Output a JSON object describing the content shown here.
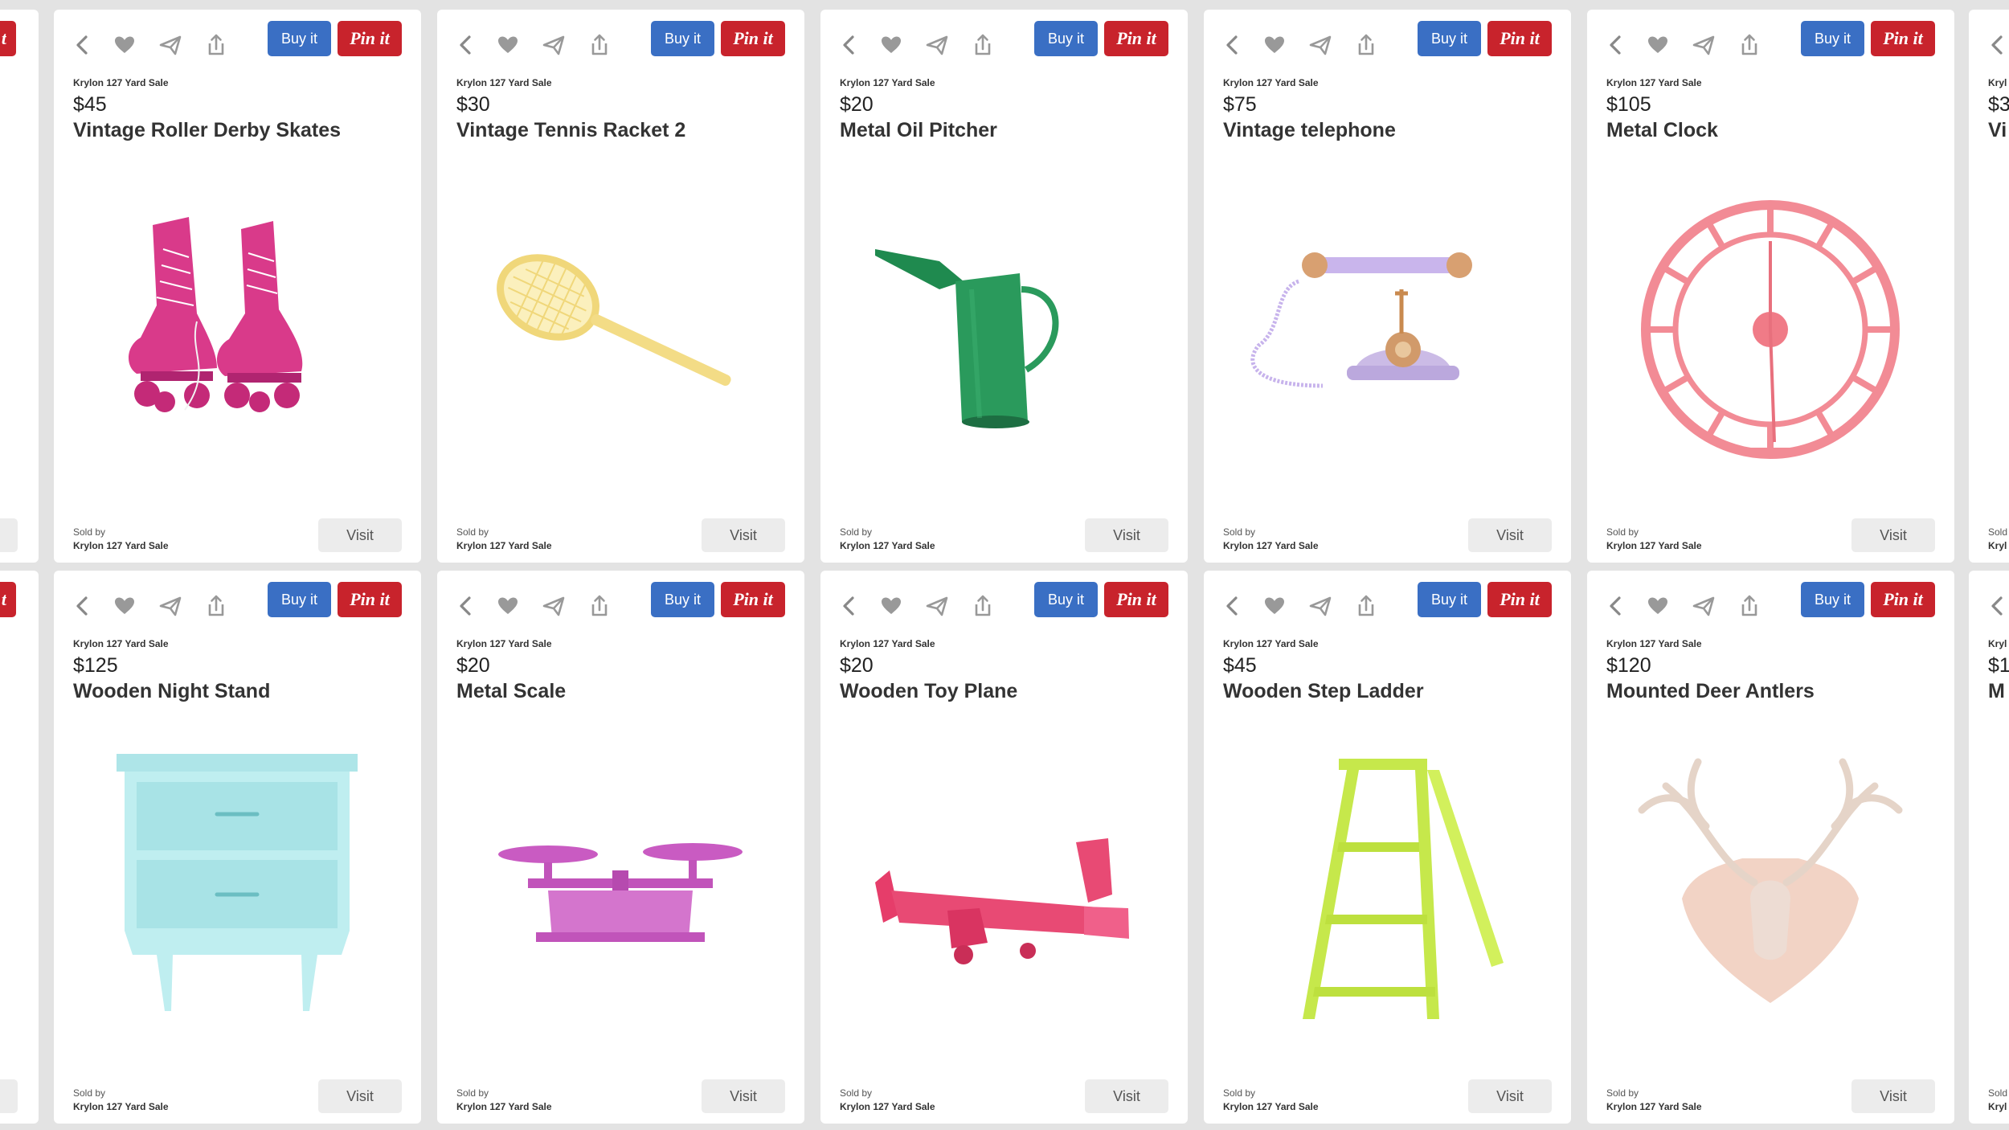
{
  "actions": {
    "buy": "Buy it",
    "pin": "Pin it",
    "visit": "Visit",
    "sold_by": "Sold by"
  },
  "seller": "Krylon 127 Yard Sale",
  "icons": [
    "back-icon",
    "heart-icon",
    "send-icon",
    "share-icon"
  ],
  "colors": {
    "buy": "#3a6fc4",
    "pin": "#c8232c",
    "background": "#e3e3e3"
  },
  "products": [
    {
      "price": "$45",
      "title": "Vintage Roller Derby Skates",
      "image": "pink roller skates"
    },
    {
      "price": "$30",
      "title": "Vintage Tennis Racket 2",
      "image": "yellow tennis racket"
    },
    {
      "price": "$20",
      "title": "Metal Oil Pitcher",
      "image": "green oil pitcher"
    },
    {
      "price": "$75",
      "title": "Vintage telephone",
      "image": "lavender rotary telephone"
    },
    {
      "price": "$105",
      "title": "Metal Clock",
      "image": "pink metal clock"
    },
    {
      "price": "$125",
      "title": "Wooden Night Stand",
      "image": "mint night stand"
    },
    {
      "price": "$20",
      "title": "Metal Scale",
      "image": "pink balance scale"
    },
    {
      "price": "$20",
      "title": "Wooden Toy Plane",
      "image": "red toy plane"
    },
    {
      "price": "$45",
      "title": "Wooden Step Ladder",
      "image": "lime step ladder"
    },
    {
      "price": "$120",
      "title": "Mounted Deer Antlers",
      "image": "mounted antlers"
    }
  ],
  "partial_right": {
    "top_price": "$3",
    "top_title": "Vi",
    "bottom_price": "$1",
    "bottom_title": "M",
    "seller": "Kryl",
    "sold": "Sold"
  },
  "partial_left": {
    "pin": "t"
  }
}
